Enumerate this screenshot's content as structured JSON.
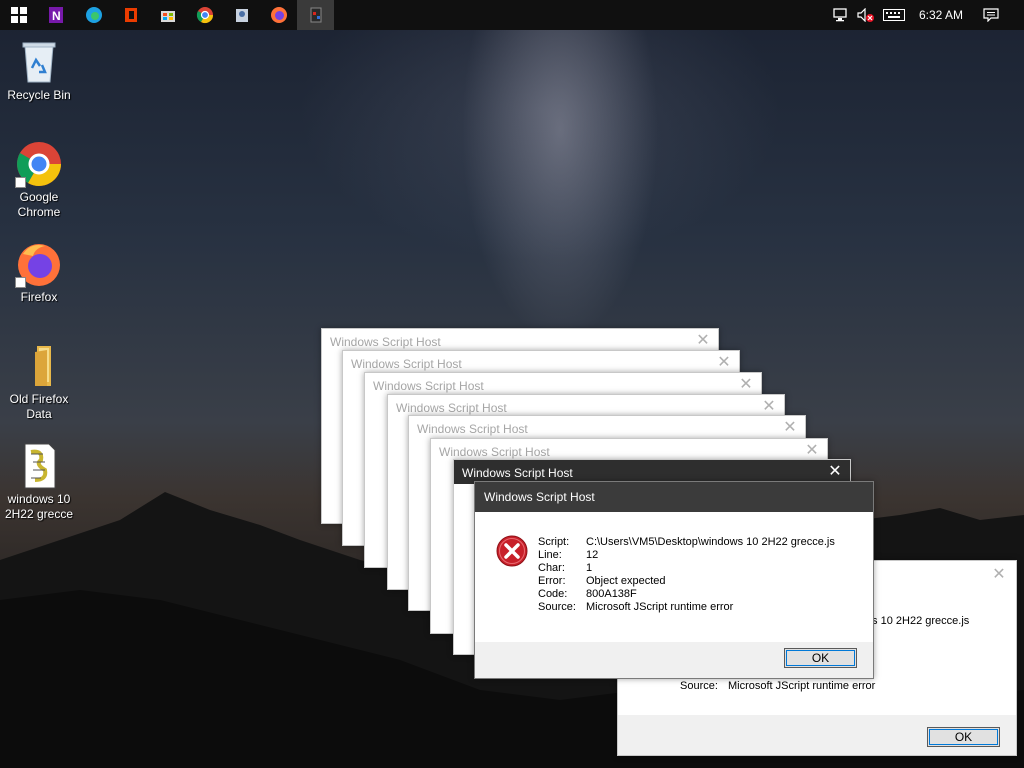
{
  "taskbar": {
    "apps": [
      {
        "name": "start-button"
      },
      {
        "name": "onenote-taskbar-button"
      },
      {
        "name": "edge-taskbar-button"
      },
      {
        "name": "office-taskbar-button"
      },
      {
        "name": "store-taskbar-button"
      },
      {
        "name": "chrome-taskbar-button"
      },
      {
        "name": "scripting-taskbar-button"
      },
      {
        "name": "firefox-taskbar-button"
      },
      {
        "name": "script-host-taskbar-button"
      }
    ],
    "clock": "6:32 AM"
  },
  "desktop_icons": [
    {
      "label": "Recycle Bin",
      "icon": "recycle-bin-icon"
    },
    {
      "label": "Google Chrome",
      "icon": "chrome-icon"
    },
    {
      "label": "Firefox",
      "icon": "firefox-icon"
    },
    {
      "label": "Old Firefox Data",
      "icon": "folder-icon"
    },
    {
      "label": "windows 10 2H22 grecce",
      "icon": "script-file-icon"
    }
  ],
  "dialogs": {
    "title": "Windows Script Host",
    "close_glyph": "✕",
    "back_dialog": {
      "script_partial": "ows 10 2H22 grecce.js",
      "source_label": "Source:",
      "source_value": "Microsoft JScript runtime error",
      "ok_label": "OK"
    },
    "main": {
      "title": "Windows Script Host",
      "rows": [
        {
          "label": "Script:",
          "value": "C:\\Users\\VM5\\Desktop\\windows 10 2H22 grecce.js"
        },
        {
          "label": "Line:",
          "value": "12"
        },
        {
          "label": "Char:",
          "value": "1"
        },
        {
          "label": "Error:",
          "value": "Object expected"
        },
        {
          "label": "Code:",
          "value": "800A138F"
        },
        {
          "label": "Source:",
          "value": "Microsoft JScript runtime error"
        }
      ],
      "ok_label": "OK"
    }
  }
}
